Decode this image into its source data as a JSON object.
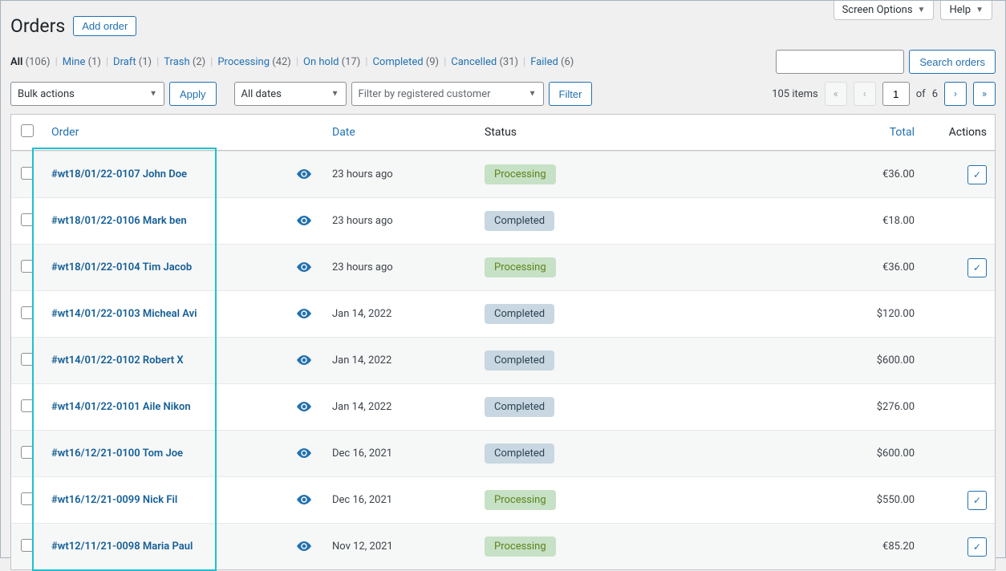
{
  "top_tabs": {
    "screen_options": "Screen Options",
    "help": "Help"
  },
  "header": {
    "title": "Orders",
    "add_button": "Add order"
  },
  "views": [
    {
      "label": "All",
      "count": "106",
      "active": true
    },
    {
      "label": "Mine",
      "count": "1",
      "active": false
    },
    {
      "label": "Draft",
      "count": "1",
      "active": false
    },
    {
      "label": "Trash",
      "count": "2",
      "active": false
    },
    {
      "label": "Processing",
      "count": "42",
      "active": false
    },
    {
      "label": "On hold",
      "count": "17",
      "active": false
    },
    {
      "label": "Completed",
      "count": "9",
      "active": false
    },
    {
      "label": "Cancelled",
      "count": "31",
      "active": false
    },
    {
      "label": "Failed",
      "count": "6",
      "active": false
    }
  ],
  "search": {
    "button": "Search orders"
  },
  "filters": {
    "bulk_actions": "Bulk actions",
    "apply": "Apply",
    "all_dates": "All dates",
    "customer_placeholder": "Filter by registered customer",
    "filter": "Filter"
  },
  "pager": {
    "items_text": "105 items",
    "current": "1",
    "of": "of",
    "total": "6"
  },
  "columns": {
    "order": "Order",
    "date": "Date",
    "status": "Status",
    "total": "Total",
    "actions": "Actions"
  },
  "rows": [
    {
      "order": "#wt18/01/22-0107 John Doe",
      "date": "23 hours ago",
      "status": "Processing",
      "status_class": "processing",
      "total": "€36.00",
      "action": true
    },
    {
      "order": "#wt18/01/22-0106 Mark ben",
      "date": "23 hours ago",
      "status": "Completed",
      "status_class": "completed",
      "total": "€18.00",
      "action": false
    },
    {
      "order": "#wt18/01/22-0104 Tim Jacob",
      "date": "23 hours ago",
      "status": "Processing",
      "status_class": "processing",
      "total": "€36.00",
      "action": true
    },
    {
      "order": "#wt14/01/22-0103 Micheal Avi",
      "date": "Jan 14, 2022",
      "status": "Completed",
      "status_class": "completed",
      "total": "$120.00",
      "action": false
    },
    {
      "order": "#wt14/01/22-0102 Robert X",
      "date": "Jan 14, 2022",
      "status": "Completed",
      "status_class": "completed",
      "total": "$600.00",
      "action": false
    },
    {
      "order": "#wt14/01/22-0101 Aile Nikon",
      "date": "Jan 14, 2022",
      "status": "Completed",
      "status_class": "completed",
      "total": "$276.00",
      "action": false
    },
    {
      "order": "#wt16/12/21-0100 Tom Joe",
      "date": "Dec 16, 2021",
      "status": "Completed",
      "status_class": "completed",
      "total": "$600.00",
      "action": false
    },
    {
      "order": "#wt16/12/21-0099 Nick Fil",
      "date": "Dec 16, 2021",
      "status": "Processing",
      "status_class": "processing",
      "total": "$550.00",
      "action": true
    },
    {
      "order": "#wt12/11/21-0098 Maria Paul",
      "date": "Nov 12, 2021",
      "status": "Processing",
      "status_class": "processing",
      "total": "€85.20",
      "action": true
    }
  ]
}
